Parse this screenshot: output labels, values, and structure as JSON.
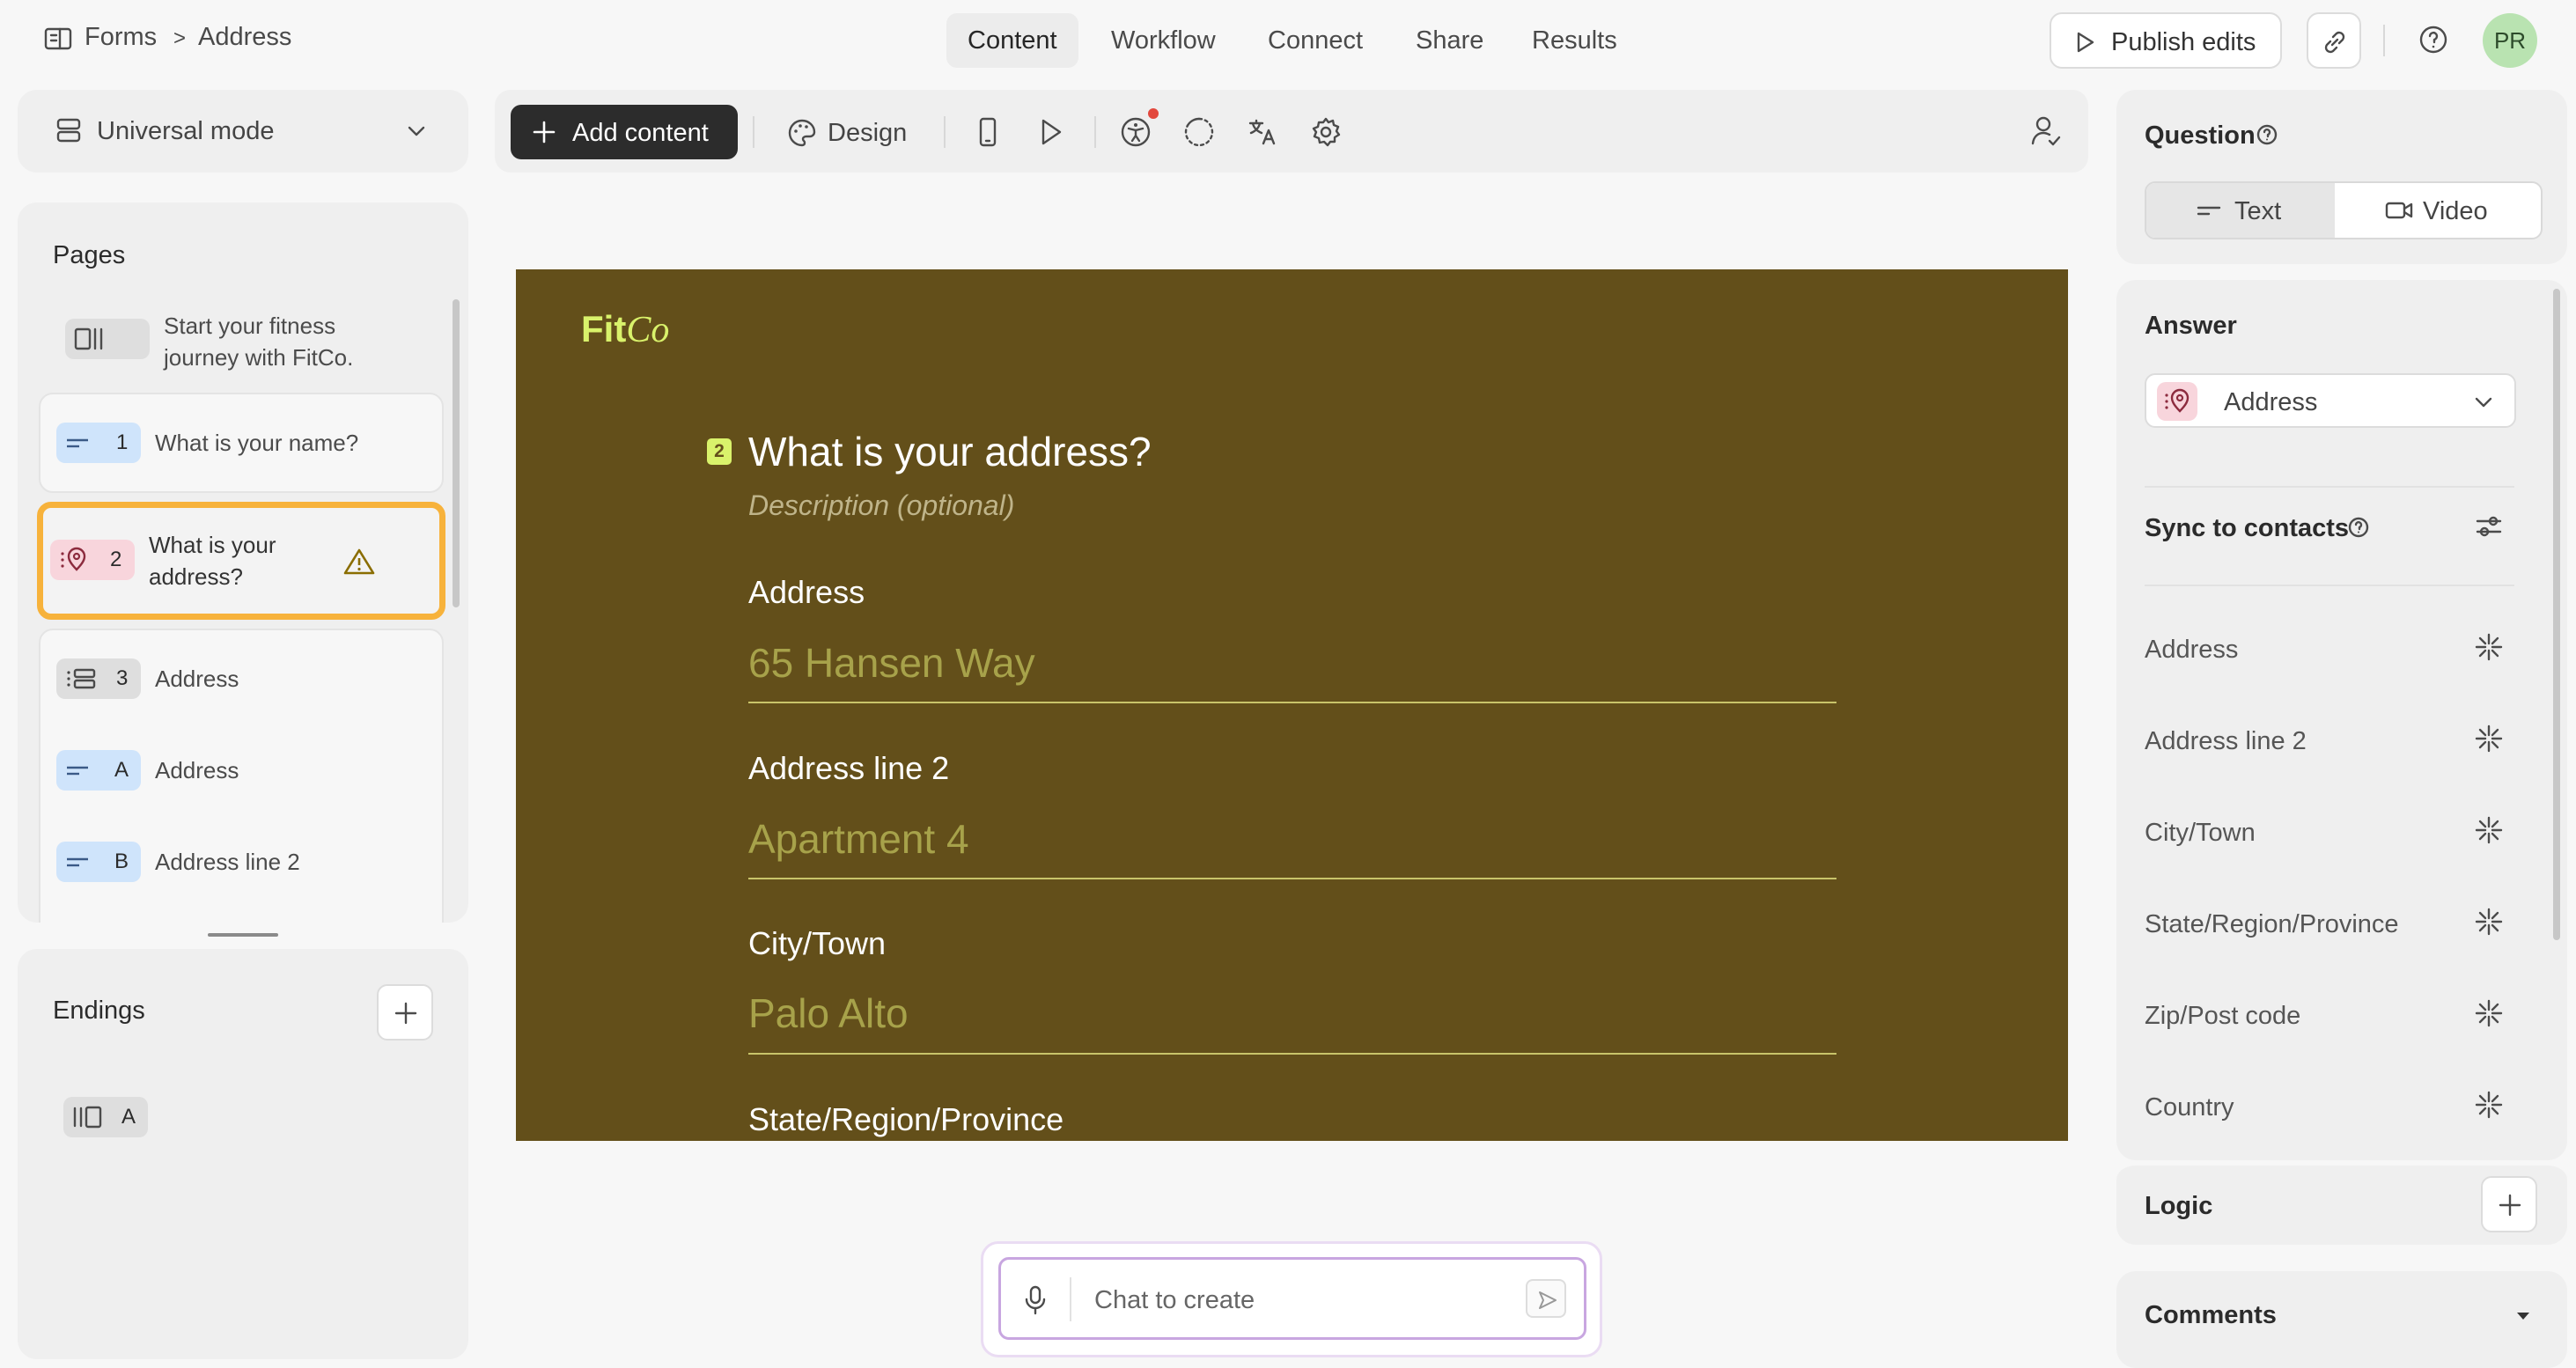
{
  "breadcrumb": {
    "root": "Forms",
    "separator": ">",
    "current": "Address"
  },
  "nav_tabs": [
    {
      "label": "Content",
      "active": true
    },
    {
      "label": "Workflow",
      "active": false
    },
    {
      "label": "Connect",
      "active": false
    },
    {
      "label": "Share",
      "active": false
    },
    {
      "label": "Results",
      "active": false
    }
  ],
  "top_actions": {
    "publish": "Publish edits",
    "avatar_initials": "PR"
  },
  "mode_select": {
    "label": "Universal mode"
  },
  "toolbar": {
    "add_content": "Add content",
    "design": "Design"
  },
  "pages": {
    "title": "Pages",
    "items": [
      {
        "chip": "",
        "label": "Start your fitness journey with FitCo."
      },
      {
        "chip": "1",
        "label": "What is your name?"
      },
      {
        "chip": "2",
        "label": "What is your address?"
      },
      {
        "chip": "3",
        "label": "Address"
      },
      {
        "chip": "A",
        "label": "Address"
      },
      {
        "chip": "B",
        "label": "Address line 2"
      }
    ]
  },
  "endings": {
    "title": "Endings",
    "item_chip": "A"
  },
  "canvas": {
    "brand_prefix": "Fit",
    "brand_suffix": "Co",
    "question_number": "2",
    "question": "What is your address?",
    "description_placeholder": "Description (optional)",
    "fields": [
      {
        "label": "Address",
        "value": "65 Hansen Way"
      },
      {
        "label": "Address line 2",
        "value": "Apartment 4"
      },
      {
        "label": "City/Town",
        "value": "Palo Alto"
      },
      {
        "label": "State/Region/Province",
        "value": ""
      }
    ],
    "background": "#634f1a",
    "accent": "#d9f26b"
  },
  "chat": {
    "placeholder": "Chat to create"
  },
  "right_panel": {
    "question_title": "Question",
    "question_types": {
      "text": "Text",
      "video": "Video"
    },
    "answer_title": "Answer",
    "answer_type": "Address",
    "sync_title": "Sync to contacts",
    "sync_fields": [
      "Address",
      "Address line 2",
      "City/Town",
      "State/Region/Province",
      "Zip/Post code",
      "Country"
    ],
    "logic_title": "Logic",
    "comments_title": "Comments"
  },
  "colors": {
    "selected_outline": "#f7b23b",
    "warning": "#8a6d00"
  }
}
